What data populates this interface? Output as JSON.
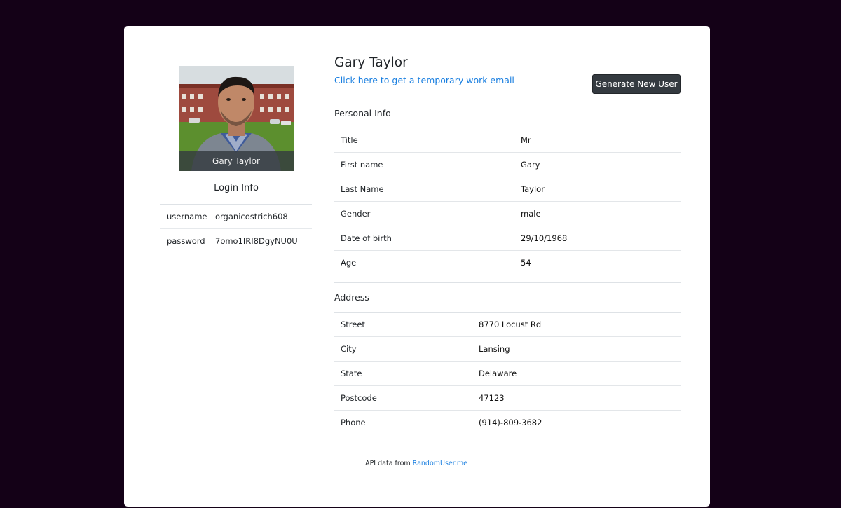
{
  "profile": {
    "photo_caption": "Gary Taylor",
    "name": "Gary Taylor",
    "temp_email_link": "Click here to get a temporary work email",
    "generate_button": "Generate New User"
  },
  "login": {
    "heading": "Login Info",
    "rows": [
      {
        "label": "username",
        "value": "organicostrich608"
      },
      {
        "label": "password",
        "value": "7omo1IRI8DgyNU0U"
      }
    ]
  },
  "personal": {
    "heading": "Personal Info",
    "rows": [
      {
        "label": "Title",
        "value": "Mr"
      },
      {
        "label": "First name",
        "value": "Gary"
      },
      {
        "label": "Last Name",
        "value": "Taylor"
      },
      {
        "label": "Gender",
        "value": "male"
      },
      {
        "label": "Date of birth",
        "value": "29/10/1968"
      },
      {
        "label": "Age",
        "value": "54"
      }
    ]
  },
  "address": {
    "heading": "Address",
    "rows": [
      {
        "label": "Street",
        "value": "8770 Locust Rd"
      },
      {
        "label": "City",
        "value": "Lansing"
      },
      {
        "label": "State",
        "value": "Delaware"
      },
      {
        "label": "Postcode",
        "value": "47123"
      },
      {
        "label": "Phone",
        "value": "(914)-809-3682"
      }
    ]
  },
  "footer": {
    "prefix": "API data from",
    "link_text": "RandomUser.me"
  },
  "colors": {
    "page_background": "#140117",
    "card_background": "#ffffff",
    "link": "#1a7fe0",
    "button": "#343a40"
  }
}
